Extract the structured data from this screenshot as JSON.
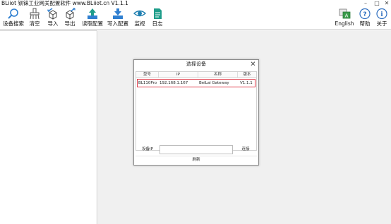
{
  "window": {
    "title": "BLiiot 钡铼工业网关配置软件 www.BLiiot.cn V1.1.1",
    "minimize": "–",
    "maximize": "□",
    "close": "✕"
  },
  "toolbar": {
    "search": "设备搜索",
    "clear": "清空",
    "import": "导入",
    "export": "导出",
    "read_config": "读取配置",
    "write_config": "写入配置",
    "monitor": "监视",
    "log": "日志",
    "english": "English",
    "help": "帮助",
    "about": "关于"
  },
  "dialog": {
    "title": "选择设备",
    "close": "✕",
    "columns": [
      "型号",
      "IP",
      "名称",
      "版本"
    ],
    "rows": [
      {
        "model": "BL110Pro",
        "ip": "192.168.1.167",
        "name": "BeiLai Gateway",
        "version": "V1.1.1"
      }
    ],
    "device_ip_label": "设备IP",
    "device_ip_value": "",
    "connect_button": "连接",
    "refresh_button": "刷新"
  },
  "colors": {
    "selected_row_border": "#e03c4a",
    "main_background": "#f0f0f0",
    "icon_blue": "#2f7fd0",
    "icon_teal": "#1f9d8a"
  }
}
